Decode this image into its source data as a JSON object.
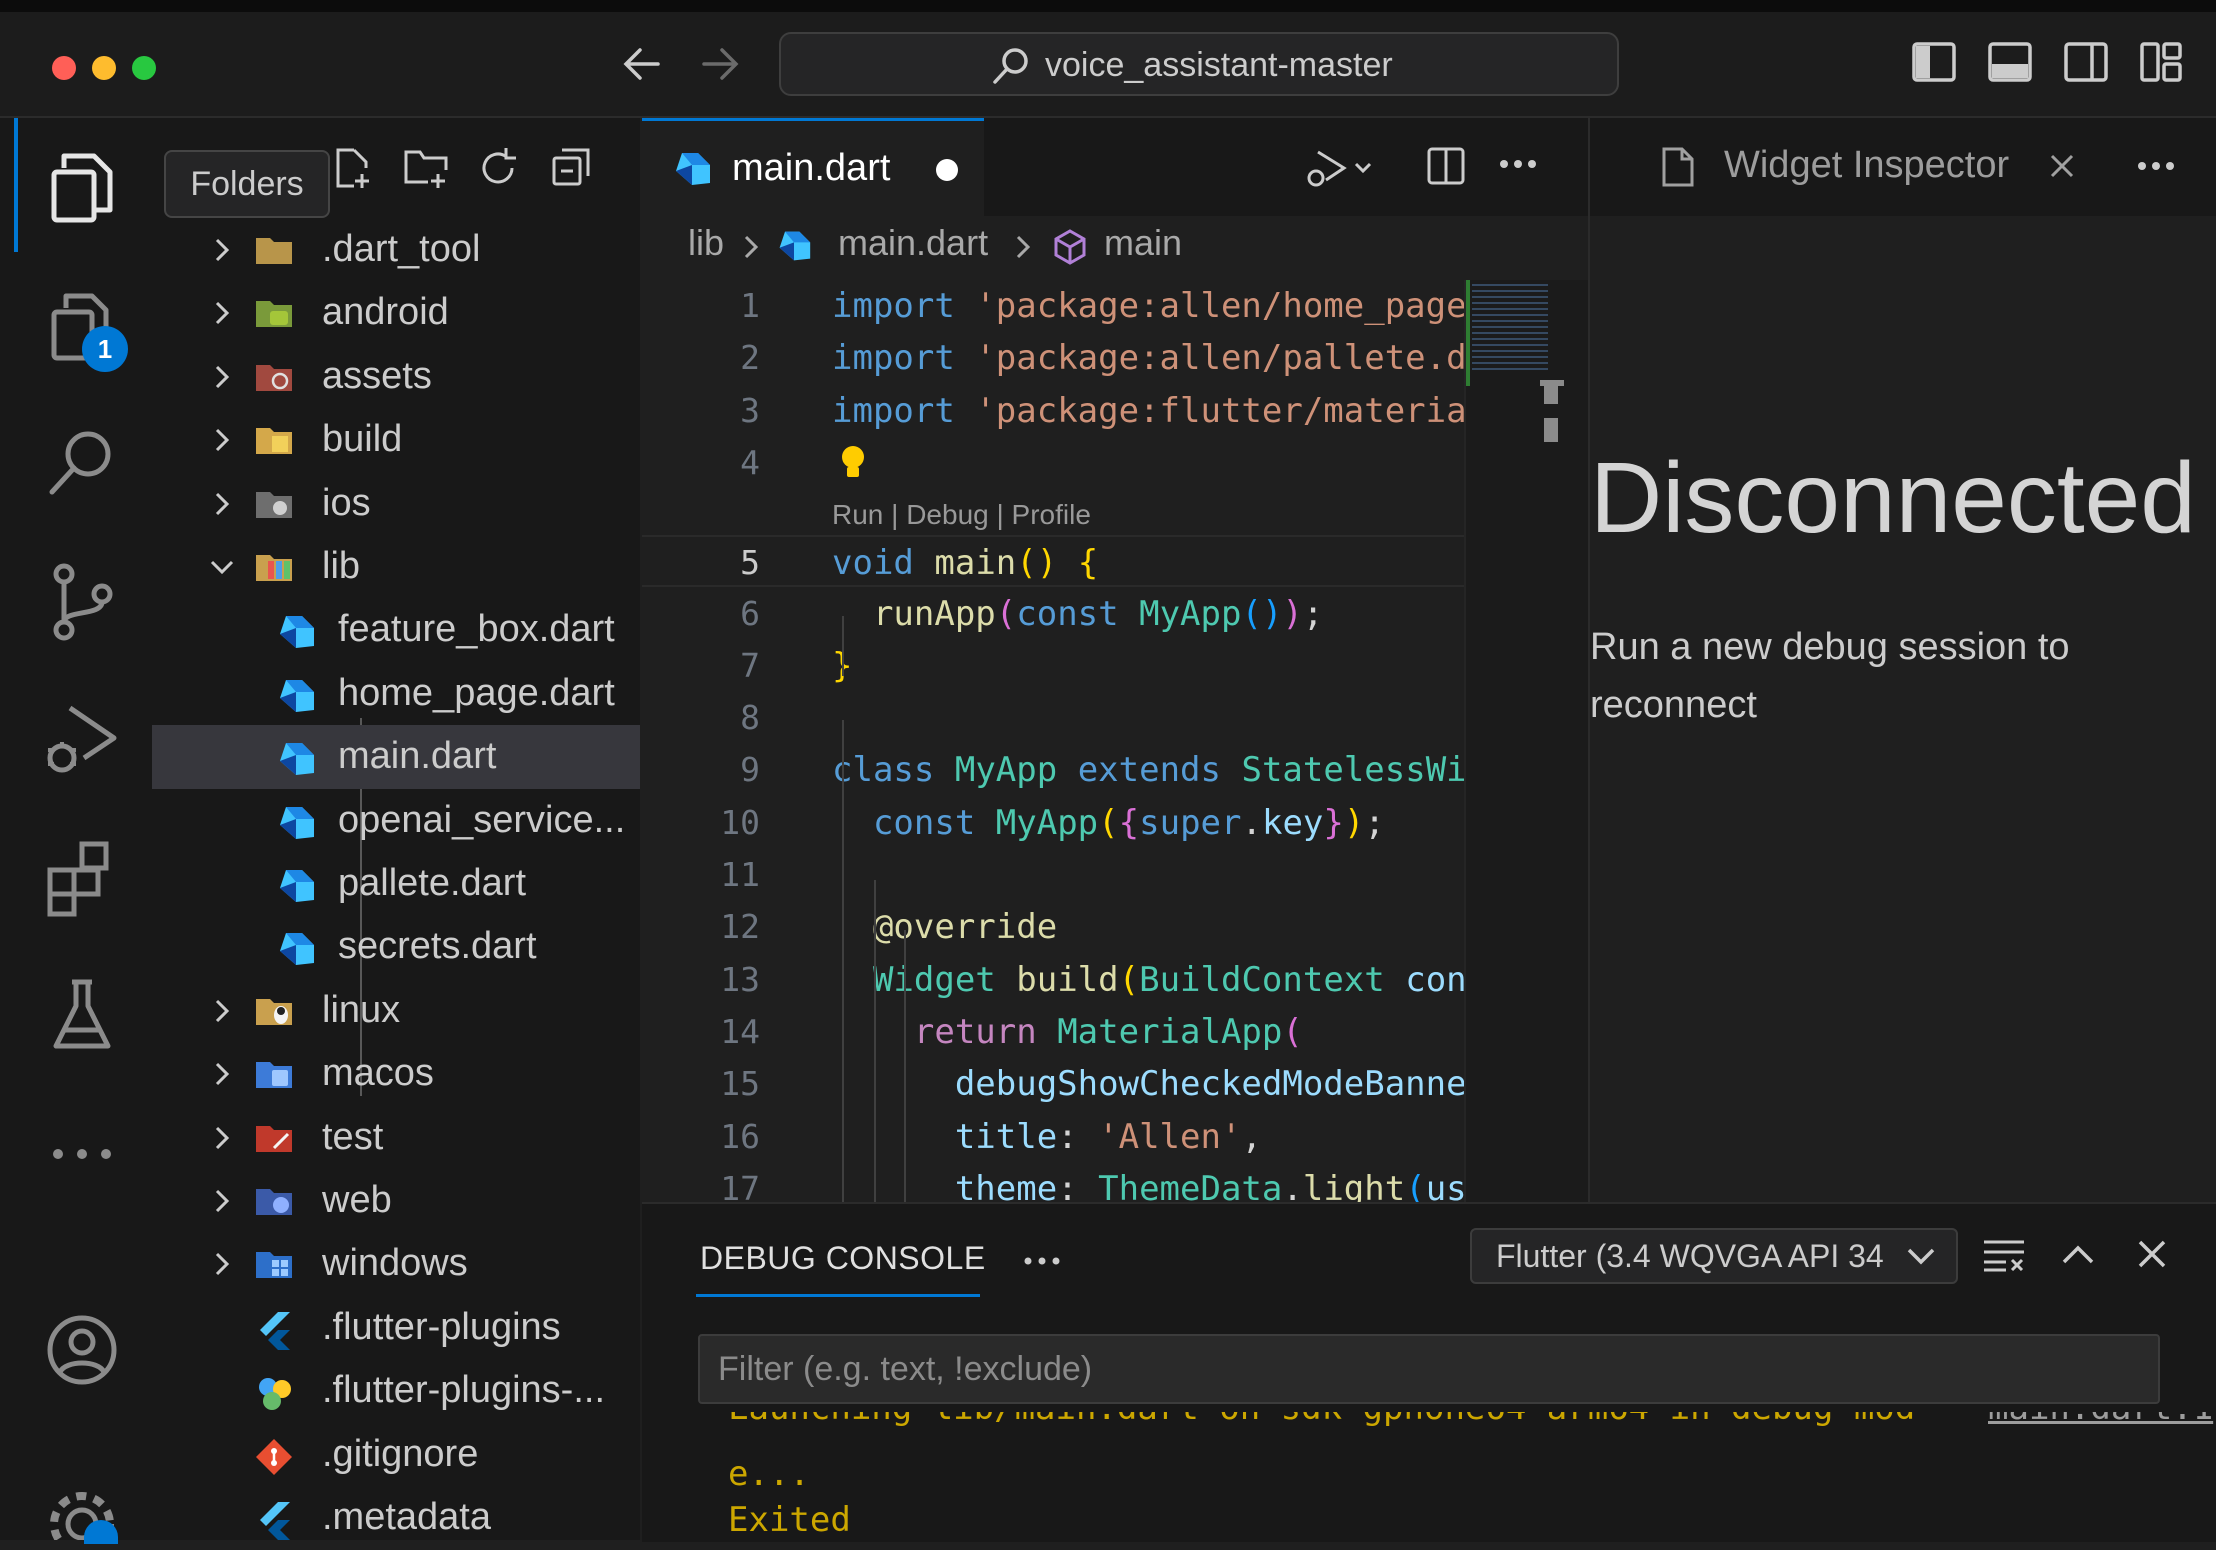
{
  "window": {
    "search_text": "voice_assistant-master",
    "traffic_lights": [
      "#ff5f57",
      "#febc2e",
      "#28c840"
    ]
  },
  "activity_bar": {
    "tooltip": "Folders",
    "source_control_badge": "1",
    "accent": "#0078d4"
  },
  "explorer": {
    "items": [
      {
        "label": ".dart_tool",
        "kind": "folder",
        "icon": "folder-icon"
      },
      {
        "label": "android",
        "kind": "folder",
        "icon": "android-folder-icon"
      },
      {
        "label": "assets",
        "kind": "folder",
        "icon": "assets-folder-icon"
      },
      {
        "label": "build",
        "kind": "folder",
        "icon": "build-folder-icon"
      },
      {
        "label": "ios",
        "kind": "folder",
        "icon": "apple-folder-icon"
      },
      {
        "label": "lib",
        "kind": "folder-open",
        "icon": "lib-folder-icon"
      },
      {
        "label": "feature_box.dart",
        "kind": "file",
        "icon": "dart-file-icon"
      },
      {
        "label": "home_page.dart",
        "kind": "file",
        "icon": "dart-file-icon"
      },
      {
        "label": "main.dart",
        "kind": "file",
        "icon": "dart-file-icon",
        "selected": true
      },
      {
        "label": "openai_service...",
        "kind": "file",
        "icon": "dart-file-icon"
      },
      {
        "label": "pallete.dart",
        "kind": "file",
        "icon": "dart-file-icon"
      },
      {
        "label": "secrets.dart",
        "kind": "file",
        "icon": "dart-file-icon"
      },
      {
        "label": "linux",
        "kind": "folder",
        "icon": "linux-folder-icon"
      },
      {
        "label": "macos",
        "kind": "folder",
        "icon": "macos-folder-icon"
      },
      {
        "label": "test",
        "kind": "folder",
        "icon": "test-folder-icon"
      },
      {
        "label": "web",
        "kind": "folder",
        "icon": "web-folder-icon"
      },
      {
        "label": "windows",
        "kind": "folder",
        "icon": "windows-folder-icon"
      },
      {
        "label": ".flutter-plugins",
        "kind": "file",
        "icon": "flutter-file-icon"
      },
      {
        "label": ".flutter-plugins-...",
        "kind": "file",
        "icon": "flutter-deps-file-icon"
      },
      {
        "label": ".gitignore",
        "kind": "file",
        "icon": "git-file-icon"
      },
      {
        "label": ".metadata",
        "kind": "file",
        "icon": "flutter-file-icon"
      }
    ]
  },
  "editor": {
    "tab_label": "main.dart",
    "breadcrumb": {
      "folder": "lib",
      "file": "main.dart",
      "symbol": "main"
    },
    "codelens": "Run | Debug | Profile",
    "lines": [
      {
        "n": "1",
        "parts": [
          [
            "import",
            "#569cd6"
          ],
          [
            " ",
            "#d4d4d4"
          ],
          [
            "'package:allen/home_page",
            "#ce9178"
          ]
        ]
      },
      {
        "n": "2",
        "parts": [
          [
            "import",
            "#569cd6"
          ],
          [
            " ",
            "#d4d4d4"
          ],
          [
            "'package:allen/pallete.d",
            "#ce9178"
          ]
        ]
      },
      {
        "n": "3",
        "parts": [
          [
            "import",
            "#569cd6"
          ],
          [
            " ",
            "#d4d4d4"
          ],
          [
            "'package:flutter/materia",
            "#ce9178"
          ]
        ]
      },
      {
        "n": "4",
        "parts": []
      },
      {
        "n": "5",
        "parts": [
          [
            "void",
            "#569cd6"
          ],
          [
            " ",
            "#d4d4d4"
          ],
          [
            "main",
            "#dcdcaa"
          ],
          [
            "() ",
            "#ffd700"
          ],
          [
            "{",
            "#ffd700"
          ]
        ]
      },
      {
        "n": "6",
        "parts": [
          [
            "  ",
            "#d4d4d4"
          ],
          [
            "runApp",
            "#dcdcaa"
          ],
          [
            "(",
            "#da70d6"
          ],
          [
            "const",
            "#569cd6"
          ],
          [
            " ",
            "#d4d4d4"
          ],
          [
            "MyApp",
            "#4ec9b0"
          ],
          [
            "()",
            "#179fff"
          ],
          [
            ")",
            "#da70d6"
          ],
          [
            ";",
            "#d4d4d4"
          ]
        ]
      },
      {
        "n": "7",
        "parts": [
          [
            "}",
            "#ffd700"
          ]
        ]
      },
      {
        "n": "8",
        "parts": []
      },
      {
        "n": "9",
        "parts": [
          [
            "class",
            "#569cd6"
          ],
          [
            " ",
            "#d4d4d4"
          ],
          [
            "MyApp",
            "#4ec9b0"
          ],
          [
            " ",
            "#d4d4d4"
          ],
          [
            "extends",
            "#569cd6"
          ],
          [
            " ",
            "#d4d4d4"
          ],
          [
            "StatelessWi",
            "#4ec9b0"
          ]
        ]
      },
      {
        "n": "10",
        "parts": [
          [
            "  ",
            "#d4d4d4"
          ],
          [
            "const",
            "#569cd6"
          ],
          [
            " ",
            "#d4d4d4"
          ],
          [
            "MyApp",
            "#4ec9b0"
          ],
          [
            "(",
            "#ffd700"
          ],
          [
            "{",
            "#da70d6"
          ],
          [
            "super",
            "#569cd6"
          ],
          [
            ".",
            "#d4d4d4"
          ],
          [
            "key",
            "#9cdcfe"
          ],
          [
            "}",
            "#da70d6"
          ],
          [
            ")",
            "#ffd700"
          ],
          [
            ";",
            "#d4d4d4"
          ]
        ]
      },
      {
        "n": "11",
        "parts": []
      },
      {
        "n": "12",
        "parts": [
          [
            "  ",
            "#d4d4d4"
          ],
          [
            "@override",
            "#dcdcaa"
          ]
        ]
      },
      {
        "n": "13",
        "parts": [
          [
            "  ",
            "#d4d4d4"
          ],
          [
            "Widget",
            "#4ec9b0"
          ],
          [
            " ",
            "#d4d4d4"
          ],
          [
            "build",
            "#dcdcaa"
          ],
          [
            "(",
            "#ffd700"
          ],
          [
            "BuildContext",
            "#4ec9b0"
          ],
          [
            " ",
            "#d4d4d4"
          ],
          [
            "con",
            "#9cdcfe"
          ]
        ]
      },
      {
        "n": "14",
        "parts": [
          [
            "    ",
            "#d4d4d4"
          ],
          [
            "return",
            "#c586c0"
          ],
          [
            " ",
            "#d4d4d4"
          ],
          [
            "MaterialApp",
            "#4ec9b0"
          ],
          [
            "(",
            "#da70d6"
          ]
        ]
      },
      {
        "n": "15",
        "parts": [
          [
            "      ",
            "#d4d4d4"
          ],
          [
            "debugShowCheckedModeBanne",
            "#9cdcfe"
          ]
        ]
      },
      {
        "n": "16",
        "parts": [
          [
            "      ",
            "#d4d4d4"
          ],
          [
            "title",
            "#9cdcfe"
          ],
          [
            ": ",
            "#d4d4d4"
          ],
          [
            "'Allen'",
            "#ce9178"
          ],
          [
            ",",
            "#d4d4d4"
          ]
        ]
      },
      {
        "n": "17",
        "parts": [
          [
            "      ",
            "#d4d4d4"
          ],
          [
            "theme",
            "#9cdcfe"
          ],
          [
            ": ",
            "#d4d4d4"
          ],
          [
            "ThemeData",
            "#4ec9b0"
          ],
          [
            ".",
            "#d4d4d4"
          ],
          [
            "light",
            "#dcdcaa"
          ],
          [
            "(",
            "#179fff"
          ],
          [
            "us",
            "#9cdcfe"
          ]
        ]
      }
    ]
  },
  "inspector": {
    "tab_label": "Widget Inspector",
    "heading": "Disconnected",
    "message_line1": "Run a new debug session to",
    "message_line2": "reconnect"
  },
  "panel": {
    "tab_label": "DEBUG CONSOLE",
    "device_select": "Flutter (3.4 WQVGA API 34",
    "filter_placeholder": "Filter (e.g. text, !exclude)",
    "console_partial": "Launching lib/main.dart on sdk gphone64 arm64 in debug mod",
    "console_link": "main.dart:1",
    "console_cont": "e...",
    "console_exited": "Exited"
  }
}
